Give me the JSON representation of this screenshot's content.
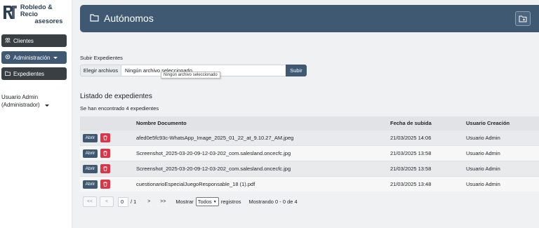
{
  "brand": {
    "line1": "Robledo & Recio",
    "line2": "asesores"
  },
  "sidebar": {
    "items": [
      {
        "label": "Clientes",
        "icon": "users-icon"
      },
      {
        "label": "Administración",
        "icon": "gear-icon"
      },
      {
        "label": "Expedientes",
        "icon": "folder-icon"
      }
    ],
    "user_name": "Usuario Admin",
    "user_role": "(Administrador)"
  },
  "header": {
    "title": "Autónomos"
  },
  "upload": {
    "label": "Subir Expedientes",
    "pick_label": "Elegir archivos",
    "file_text": "Ningún archivo seleccionado",
    "submit_label": "Subir",
    "tooltip": "Ningún archivo seleccionado"
  },
  "list": {
    "title": "Listado de expedientes",
    "count_text": "Se han encontrado 4 expedientes",
    "columns": [
      "Nombre Documento",
      "Fecha de subida",
      "Usuario Creación"
    ],
    "open_label": "Abrir",
    "rows": [
      {
        "name": "afed0e5fc93c-WhatsApp_Image_2025_01_22_at_9.10.27_AM.jpeg",
        "date": "21/03/2025 14:06",
        "user": "Usuario Admin"
      },
      {
        "name": "Screenshot_2025-03-20-09-12-03-202_com.salesland.oncecfc.jpg",
        "date": "21/03/2025 13:58",
        "user": "Usuario Admin"
      },
      {
        "name": "Screenshot_2025-03-20-09-12-03-202_com.salesland.oncecfc.jpg",
        "date": "21/03/2025 13:58",
        "user": "Usuario Admin"
      },
      {
        "name": "cuestionarioEspecialJuegoResponsable_18 (1).pdf",
        "date": "21/03/2025 13:48",
        "user": "Usuario Admin"
      }
    ]
  },
  "pager": {
    "first": "<<",
    "prev": "<",
    "page": "0",
    "of": "/ 1",
    "next": ">",
    "last": ">>",
    "show_label": "Mostrar",
    "show_value": "Todos",
    "records_label": "registros",
    "showing": "Mostrando 0 - 0 de 4"
  },
  "colors": {
    "primary": "#3f5973",
    "danger": "#dc3545",
    "sidebar_button": "#3a3f44"
  }
}
